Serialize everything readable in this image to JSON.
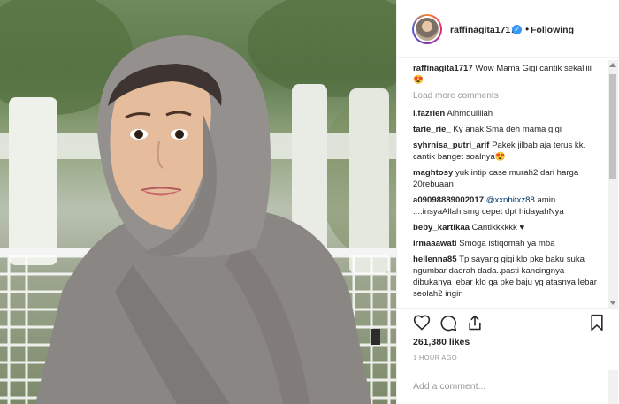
{
  "post": {
    "author": "raffinagita1717",
    "follow_label": "Following",
    "dot": "•",
    "verified_mark": "✓",
    "caption": {
      "user": "raffinagita1717",
      "text": "Wow Mama Gigi cantik sekaliiii 😍"
    },
    "load_more": "Load more comments",
    "likes": "261,380 likes",
    "time": "1 HOUR AGO",
    "add_comment_placeholder": "Add a comment..."
  },
  "comments": [
    {
      "user": "l.fazrien",
      "text": "Alhmdulillah"
    },
    {
      "user": "tarie_rie_",
      "text": "Ky anak Sma deh mama gigi"
    },
    {
      "user": "syhrnisa_putri_arif",
      "text": "Pakek jilbab aja terus kk. cantik banget soalnya😍"
    },
    {
      "user": "maghtosy",
      "text": "yuk intip case murah2 dari harga 20rebuaan"
    },
    {
      "user": "a09098889002017",
      "mention": "@xxnbitxz88",
      "text": "amin ....insyaAllah smg cepet dpt hidayahNya"
    },
    {
      "user": "beby_kartikaa",
      "text": "Cantikkkkkk ♥"
    },
    {
      "user": "irmaaawati",
      "text": "Smoga istiqomah ya mba"
    },
    {
      "user": "hellenna85",
      "text": "Tp sayang gigi klo pke baku suka ngumbar daerah dada..pasti kancingnya dibukanya lebar klo ga pke baju yg atasnya lebar seolah2 ingin"
    }
  ],
  "icons": {
    "heart": "heart-icon",
    "comment": "comment-icon",
    "share": "share-icon",
    "bookmark": "bookmark-icon"
  },
  "colors": {
    "verified": "#3897f0",
    "link": "#003569",
    "muted": "#999999"
  }
}
